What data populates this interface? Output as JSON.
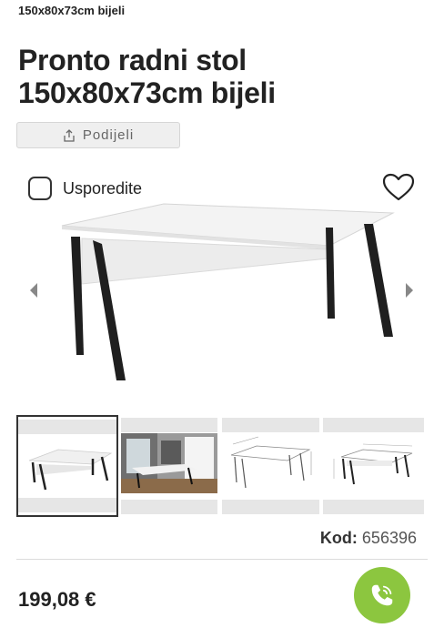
{
  "breadcrumb": "150x80x73cm bijeli",
  "product": {
    "title_line1": "Pronto radni stol",
    "title_line2": "150x80x73cm bijeli",
    "code_label": "Kod:",
    "code_value": "656396",
    "price": "199,08 €"
  },
  "actions": {
    "share_label": "Podijeli",
    "compare_label": "Usporedite"
  },
  "gallery": {
    "thumbnail_count": 4,
    "active_index": 0
  },
  "colors": {
    "accent_call": "#8cc63f",
    "text": "#222222",
    "share_bg": "#efefef"
  },
  "icons": [
    "share-icon",
    "heart-icon",
    "chevron-left-icon",
    "chevron-right-icon",
    "phone-icon"
  ]
}
